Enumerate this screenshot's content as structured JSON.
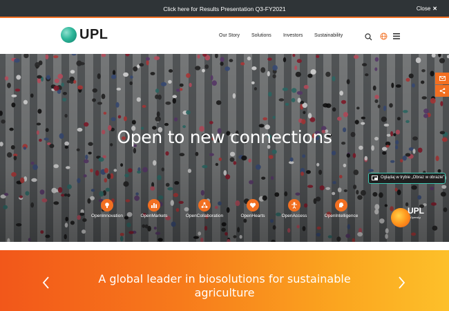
{
  "announcement": {
    "text": "Click here for Results Presentation Q3-FY2021",
    "close_label": "Close"
  },
  "header": {
    "logo_text": "UPL",
    "nav": [
      "Our Story",
      "Solutions",
      "Investors",
      "Sustainability"
    ]
  },
  "hero": {
    "title": "Open to new connections",
    "features": [
      {
        "label": "OpenInnovation",
        "icon": "lightbulb-icon"
      },
      {
        "label": "OpenMarkets",
        "icon": "bar-chart-icon"
      },
      {
        "label": "OpenCollaboration",
        "icon": "network-icon"
      },
      {
        "label": "OpenHearts",
        "icon": "heart-icon"
      },
      {
        "label": "OpenAccess",
        "icon": "person-icon"
      },
      {
        "label": "OpenIntelligence",
        "icon": "brain-icon"
      }
    ],
    "pip_label": "Oglądaj w trybie „Obraz w obrazie\"",
    "brand_logo_text": "UPL",
    "brand_logo_sub": "OpenAg"
  },
  "banner": {
    "text": "A global leader in biosolutions for sustainable agriculture"
  },
  "colors": {
    "accent": "#f26f21",
    "topbar": "#2f3437",
    "pip_border": "#3ec9b4"
  }
}
